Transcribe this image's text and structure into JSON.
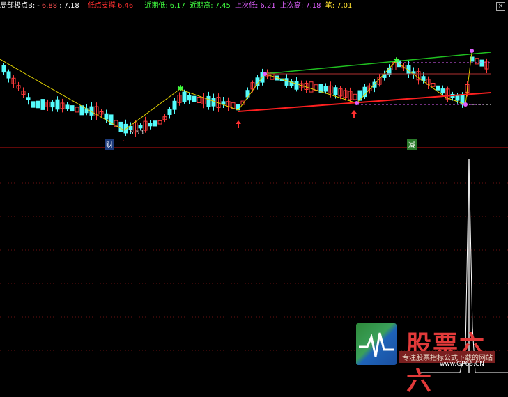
{
  "header": {
    "indicator_name": "局部极点B:",
    "dash": "-",
    "val1": "6.88",
    "val2": "7.18",
    "support_label": "低点支撑",
    "support_value": "6.46",
    "recent_low_label": "近期低:",
    "recent_low_value": "6.17",
    "recent_high_label": "近期高:",
    "recent_high_value": "7.45",
    "last_low_label": "上次低:",
    "last_low_value": "6.21",
    "last_high_label": "上次高:",
    "last_high_value": "7.18",
    "stroke_label": "笔:",
    "stroke_value": "7.01",
    "close_icon": "close-icon"
  },
  "chart": {
    "low_price_label": "5.53",
    "marker_cai": "财",
    "marker_jian": "减",
    "colors": {
      "up": "#ff3b3b",
      "down": "#54fcfc",
      "zigzag": "#e0d000",
      "support_line": "#ff2020",
      "resistance_line": "#20c020",
      "panel_border": "#c01010",
      "grid": "#6a1010",
      "indicator_line": "#ffffff"
    }
  },
  "watermark": {
    "title": "股票六六",
    "subtitle": "专注股票指标公式下载的网站",
    "url": "www.GP66.CN",
    "logo_icon": "pulse-logo-icon"
  }
}
